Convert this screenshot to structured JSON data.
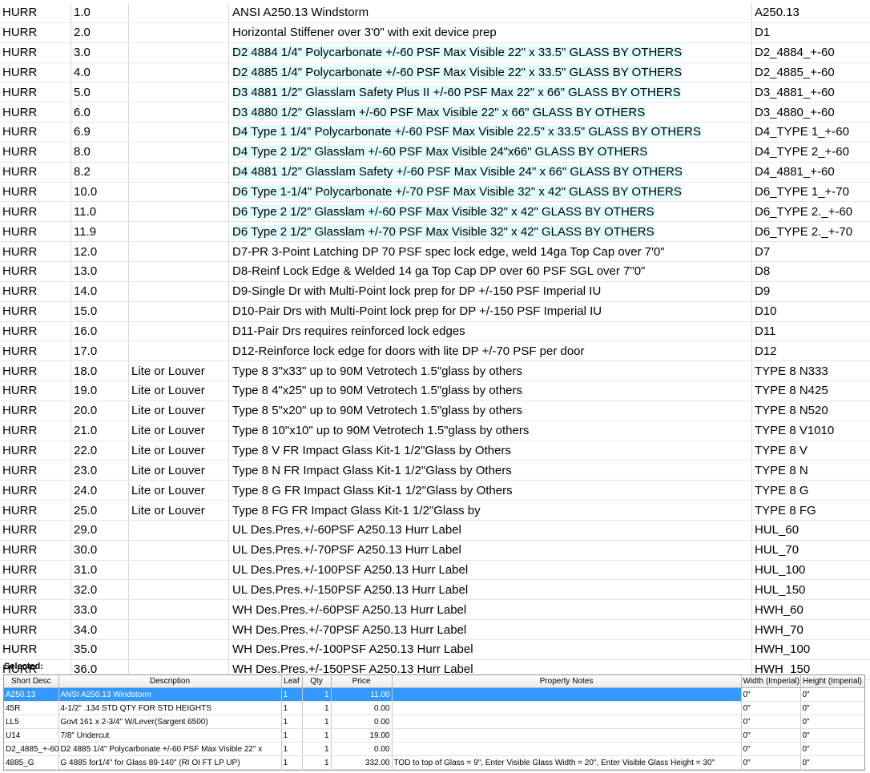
{
  "options": [
    {
      "code": "HURR",
      "seq": "1.0",
      "cat": "",
      "desc": "ANSI A250.13 Windstorm",
      "part": "A250.13",
      "highlight": false
    },
    {
      "code": "HURR",
      "seq": "2.0",
      "cat": "",
      "desc": "Horizontal Stiffener over 3'0\" with exit device prep",
      "part": "D1",
      "highlight": false
    },
    {
      "code": "HURR",
      "seq": "3.0",
      "cat": "",
      "desc": "D2 4884 1/4\" Polycarbonate +/-60 PSF Max Visible 22\" x 33.5\" GLASS BY OTHERS",
      "part": "D2_4884_+-60",
      "highlight": true
    },
    {
      "code": "HURR",
      "seq": "4.0",
      "cat": "",
      "desc": "D2 4885 1/4\" Polycarbonate +/-60 PSF Max Visible 22\" x 33.5\" GLASS BY OTHERS",
      "part": "D2_4885_+-60",
      "highlight": true
    },
    {
      "code": "HURR",
      "seq": "5.0",
      "cat": "",
      "desc": "D3 4881 1/2\" Glasslam Safety Plus II +/-60 PSF Max 22\" x 66\" GLASS BY OTHERS",
      "part": "D3_4881_+-60",
      "highlight": true
    },
    {
      "code": "HURR",
      "seq": "6.0",
      "cat": "",
      "desc": "D3 4880 1/2\" Glasslam +/-60 PSF Max Visible 22\" x 66\" GLASS BY OTHERS",
      "part": "D3_4880_+-60",
      "highlight": true
    },
    {
      "code": "HURR",
      "seq": "6.9",
      "cat": "",
      "desc": "D4 Type 1 1/4\" Polycarbonate +/-60 PSF Max Visible 22.5\" x 33.5\" GLASS BY OTHERS",
      "part": "D4_TYPE 1_+-60",
      "highlight": true
    },
    {
      "code": "HURR",
      "seq": "8.0",
      "cat": "",
      "desc": "D4 Type 2 1/2\" Glasslam +/-60 PSF Max Visible 24\"x66\" GLASS BY OTHERS",
      "part": "D4_TYPE 2_+-60",
      "highlight": true
    },
    {
      "code": "HURR",
      "seq": "8.2",
      "cat": "",
      "desc": "D4 4881 1/2\" Glasslam Safety +/-60 PSF Max Visible 24\" x 66\" GLASS BY OTHERS",
      "part": "D4_4881_+-60",
      "highlight": true
    },
    {
      "code": "HURR",
      "seq": "10.0",
      "cat": "",
      "desc": "D6 Type 1-1/4\" Polycarbonate +/-70 PSF Max Visible 32\" x 42\" GLASS BY OTHERS",
      "part": "D6_TYPE 1_+-70",
      "highlight": true
    },
    {
      "code": "HURR",
      "seq": "11.0",
      "cat": "",
      "desc": "D6 Type 2 1/2\" Glasslam +/-60 PSF Max Visible 32\" x 42\" GLASS BY OTHERS",
      "part": "D6_TYPE 2._+-60",
      "highlight": true
    },
    {
      "code": "HURR",
      "seq": "11.9",
      "cat": "",
      "desc": "D6 Type 2 1/2\" Glasslam +/-70 PSF Max Visible 32\" x 42\" GLASS BY OTHERS",
      "part": "D6_TYPE 2._+-70",
      "highlight": true
    },
    {
      "code": "HURR",
      "seq": "12.0",
      "cat": "",
      "desc": "D7-PR 3-Point Latching DP 70 PSF spec lock edge, weld 14ga Top Cap over 7'0\"",
      "part": "D7",
      "highlight": false
    },
    {
      "code": "HURR",
      "seq": "13.0",
      "cat": "",
      "desc": "D8-Reinf Lock Edge & Welded 14 ga Top Cap DP over 60 PSF SGL over 7\"0\"",
      "part": "D8",
      "highlight": false
    },
    {
      "code": "HURR",
      "seq": "14.0",
      "cat": "",
      "desc": "D9-Single Dr with Multi-Point lock prep for DP +/-150 PSF Imperial IU",
      "part": "D9",
      "highlight": false
    },
    {
      "code": "HURR",
      "seq": "15.0",
      "cat": "",
      "desc": "D10-Pair Drs with Multi-Point lock prep for DP +/-150 PSF Imperial IU",
      "part": "D10",
      "highlight": false
    },
    {
      "code": "HURR",
      "seq": "16.0",
      "cat": "",
      "desc": "D11-Pair Drs requires reinforced lock edges",
      "part": "D11",
      "highlight": false
    },
    {
      "code": "HURR",
      "seq": "17.0",
      "cat": "",
      "desc": "D12-Reinforce lock edge for doors with lite DP +/-70 PSF per door",
      "part": "D12",
      "highlight": false
    },
    {
      "code": "HURR",
      "seq": "18.0",
      "cat": "Lite or Louver",
      "desc": "Type 8 3\"x33\" up to 90M Vetrotech 1.5\"glass by others",
      "part": "TYPE 8 N333",
      "highlight": false
    },
    {
      "code": "HURR",
      "seq": "19.0",
      "cat": "Lite or Louver",
      "desc": "Type 8 4\"x25\" up to 90M Vetrotech 1.5\"glass by others",
      "part": "TYPE 8 N425",
      "highlight": false
    },
    {
      "code": "HURR",
      "seq": "20.0",
      "cat": "Lite or Louver",
      "desc": "Type 8 5\"x20\" up to 90M Vetrotech 1.5\"glass by others",
      "part": "TYPE 8 N520",
      "highlight": false
    },
    {
      "code": "HURR",
      "seq": "21.0",
      "cat": "Lite or Louver",
      "desc": "Type 8 10\"x10\" up to 90M Vetrotech 1.5\"glass by others",
      "part": "TYPE 8 V1010",
      "highlight": false
    },
    {
      "code": "HURR",
      "seq": "22.0",
      "cat": "Lite or Louver",
      "desc": "Type 8 V FR Impact Glass Kit-1 1/2\"Glass by Others",
      "part": "TYPE 8 V",
      "highlight": false
    },
    {
      "code": "HURR",
      "seq": "23.0",
      "cat": "Lite or Louver",
      "desc": "Type 8 N FR Impact Glass Kit-1 1/2\"Glass by Others",
      "part": "TYPE 8 N",
      "highlight": false
    },
    {
      "code": "HURR",
      "seq": "24.0",
      "cat": "Lite or Louver",
      "desc": "Type 8 G FR Impact Glass Kit-1 1/2\"Glass by Others",
      "part": "TYPE 8 G",
      "highlight": false
    },
    {
      "code": "HURR",
      "seq": "25.0",
      "cat": "Lite or Louver",
      "desc": "Type 8 FG FR Impact Glass Kit-1 1/2\"Glass by",
      "part": "TYPE 8 FG",
      "highlight": false
    },
    {
      "code": "HURR",
      "seq": "29.0",
      "cat": "",
      "desc": "UL Des.Pres.+/-60PSF A250.13 Hurr Label",
      "part": "HUL_60",
      "highlight": false
    },
    {
      "code": "HURR",
      "seq": "30.0",
      "cat": "",
      "desc": "UL Des.Pres.+/-70PSF A250.13 Hurr Label",
      "part": "HUL_70",
      "highlight": false
    },
    {
      "code": "HURR",
      "seq": "31.0",
      "cat": "",
      "desc": "UL Des.Pres.+/-100PSF A250.13 Hurr Label",
      "part": "HUL_100",
      "highlight": false
    },
    {
      "code": "HURR",
      "seq": "32.0",
      "cat": "",
      "desc": "UL Des.Pres.+/-150PSF A250.13 Hurr Label",
      "part": "HUL_150",
      "highlight": false
    },
    {
      "code": "HURR",
      "seq": "33.0",
      "cat": "",
      "desc": "WH Des.Pres.+/-60PSF A250.13 Hurr Label",
      "part": "HWH_60",
      "highlight": false
    },
    {
      "code": "HURR",
      "seq": "34.0",
      "cat": "",
      "desc": "WH Des.Pres.+/-70PSF A250.13 Hurr Label",
      "part": "HWH_70",
      "highlight": false
    },
    {
      "code": "HURR",
      "seq": "35.0",
      "cat": "",
      "desc": "WH Des.Pres.+/-100PSF A250.13 Hurr Label",
      "part": "HWH_100",
      "highlight": false
    },
    {
      "code": "HURR",
      "seq": "36.0",
      "cat": "",
      "desc": "WH Des.Pres.+/-150PSF A250.13 Hurr Label",
      "part": "HWH_150",
      "highlight": false
    }
  ],
  "selected": {
    "title": "Selected:",
    "columns": [
      "Short Desc",
      "Description",
      "Leaf",
      "Qty",
      "Price",
      "Property Notes",
      "Width (Imperial)",
      "Height (Imperial)"
    ],
    "rows": [
      {
        "short": "A250.13",
        "desc": "ANSI A250.13 Windstorm",
        "leaf": "1",
        "qty": "1",
        "price": "11.00",
        "notes": "",
        "width": "0\"",
        "height": "0\"",
        "selected": true
      },
      {
        "short": "45R",
        "desc": "4-1/2\" .134 STD QTY FOR STD HEIGHTS",
        "leaf": "1",
        "qty": "1",
        "price": "0.00",
        "notes": "",
        "width": "0\"",
        "height": "0\"",
        "selected": false
      },
      {
        "short": "LL5",
        "desc": "Govt 161 x 2-3/4\" W/Lever(Sargent 6500)",
        "leaf": "1",
        "qty": "1",
        "price": "0.00",
        "notes": "",
        "width": "0\"",
        "height": "0\"",
        "selected": false
      },
      {
        "short": "U14",
        "desc": "7/8\" Undercut",
        "leaf": "1",
        "qty": "1",
        "price": "19.00",
        "notes": "",
        "width": "0\"",
        "height": "0\"",
        "selected": false
      },
      {
        "short": "D2_4885_+-60",
        "desc": "D2 4885 1/4\" Polycarbonate +/-60 PSF Max Visible 22\" x",
        "leaf": "1",
        "qty": "1",
        "price": "0.00",
        "notes": "",
        "width": "0\"",
        "height": "0\"",
        "selected": false
      },
      {
        "short": "4885_G",
        "desc": "G 4885 for1/4\" for Glass 89-140\" (RI OI FT LP UP)",
        "leaf": "1",
        "qty": "1",
        "price": "332.00",
        "notes": "TOD to top of Glass = 9\", Enter Visible Glass Width = 20\", Enter Visible Glass Height = 30\"",
        "width": "0\"",
        "height": "0\"",
        "selected": false
      }
    ]
  },
  "colors": {
    "highlight": "#e0fbfb",
    "selection": "#3399ff"
  }
}
